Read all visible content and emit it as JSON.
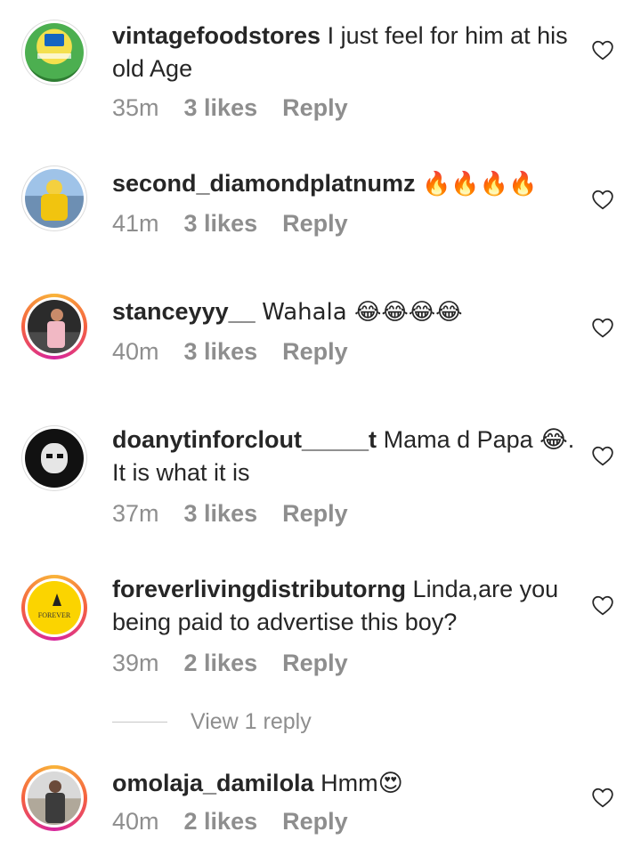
{
  "comments": [
    {
      "username": "vintagefoodstores",
      "text": "I just feel for him at his old Age",
      "time": "35m",
      "likes": "3 likes",
      "reply": "Reply"
    },
    {
      "username": "second_diamondplatnumz",
      "text": "🔥🔥🔥🔥",
      "time": "41m",
      "likes": "3 likes",
      "reply": "Reply"
    },
    {
      "username": "stanceyyy__",
      "text": "Wahala 😂😂😂😂",
      "time": "40m",
      "likes": "3 likes",
      "reply": "Reply"
    },
    {
      "username": "doanytinforclout_____t",
      "text": "Mama d Papa 😂. It is what it is",
      "time": "37m",
      "likes": "3 likes",
      "reply": "Reply"
    },
    {
      "username": "foreverlivingdistributorng",
      "text": "Linda,are you being paid to advertise this boy?",
      "time": "39m",
      "likes": "2 likes",
      "reply": "Reply",
      "avatar_logo": "FOREVER"
    },
    {
      "username": "omolaja_damilola",
      "text": "Hmm😍",
      "time": "40m",
      "likes": "2 likes",
      "reply": "Reply"
    }
  ],
  "view_replies": "View 1 reply",
  "icons": {
    "like": "heart-outline-icon"
  },
  "colors": {
    "text": "#262626",
    "secondary": "#8e8e8e"
  }
}
